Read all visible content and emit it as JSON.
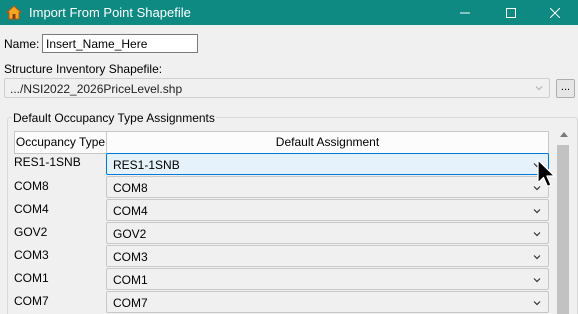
{
  "window": {
    "title": "Import From Point Shapefile",
    "icon": "house-icon",
    "controls": [
      "minimize-icon",
      "maximize-icon",
      "close-icon"
    ]
  },
  "name_field": {
    "label": "Name:",
    "value": "Insert_Name_Here"
  },
  "structure_inventory": {
    "label": "Structure Inventory Shapefile:",
    "path": ".../NSI2022_2026PriceLevel.shp",
    "browse_label": "..."
  },
  "assignments": {
    "group_title": "Default Occupancy Type Assignments",
    "headers": {
      "occupancy_type": "Occupancy Type",
      "default_assignment": "Default Assignment"
    },
    "rows": [
      {
        "occupancy_type": "RES1-1SNB",
        "assignment": "RES1-1SNB",
        "highlighted": true
      },
      {
        "occupancy_type": "COM8",
        "assignment": "COM8",
        "highlighted": false
      },
      {
        "occupancy_type": "COM4",
        "assignment": "COM4",
        "highlighted": false
      },
      {
        "occupancy_type": "GOV2",
        "assignment": "GOV2",
        "highlighted": false
      },
      {
        "occupancy_type": "COM3",
        "assignment": "COM3",
        "highlighted": false
      },
      {
        "occupancy_type": "COM1",
        "assignment": "COM1",
        "highlighted": false
      },
      {
        "occupancy_type": "COM7",
        "assignment": "COM7",
        "highlighted": false
      }
    ]
  },
  "colors": {
    "titlebar": "#0f8a83",
    "highlight_fill": "#e5f1fb",
    "highlight_border": "#0078d7"
  }
}
